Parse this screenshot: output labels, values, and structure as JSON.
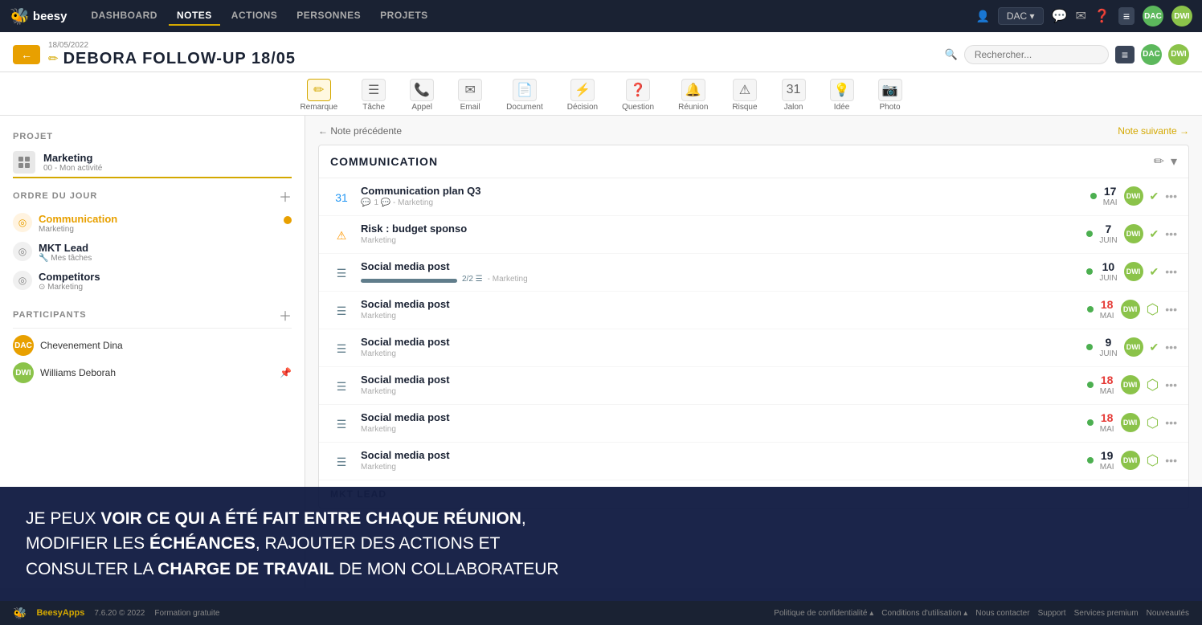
{
  "app": {
    "logo": "Beesy",
    "bee_icon": "🐝"
  },
  "topnav": {
    "items": [
      {
        "label": "DASHBOARD",
        "active": false
      },
      {
        "label": "NOTES",
        "active": true
      },
      {
        "label": "ACTIONS",
        "active": false
      },
      {
        "label": "PERSONNES",
        "active": false
      },
      {
        "label": "PROJETS",
        "active": false
      }
    ],
    "user_label": "DAC ▾",
    "search_placeholder": "Rechercher..."
  },
  "header": {
    "date": "18/05/2022",
    "title": "DEBORA FOLLOW-UP 18/05",
    "back_icon": "←",
    "edit_icon": "✏"
  },
  "toolbar": {
    "tools": [
      {
        "name": "Remarque",
        "icon": "✏"
      },
      {
        "name": "Tâche",
        "icon": "☰"
      },
      {
        "name": "Appel",
        "icon": "📞"
      },
      {
        "name": "Email",
        "icon": "✉"
      },
      {
        "name": "Document",
        "icon": "📄"
      },
      {
        "name": "Décision",
        "icon": "⚡"
      },
      {
        "name": "Question",
        "icon": "❓"
      },
      {
        "name": "Réunion",
        "icon": "🔔"
      },
      {
        "name": "Risque",
        "icon": "⚠"
      },
      {
        "name": "Jalon",
        "icon": "31"
      },
      {
        "name": "Idée",
        "icon": "💡"
      },
      {
        "name": "Photo",
        "icon": "📷"
      }
    ]
  },
  "sidebar": {
    "project_section": "PROJET",
    "agenda_section": "ORDRE DU JOUR",
    "participants_section": "PARTICIPANTS",
    "project": {
      "name": "Marketing",
      "sub": "00 - Mon activité"
    },
    "agenda_items": [
      {
        "name": "Communication",
        "sub": "Marketing",
        "active": true,
        "has_dot": true
      },
      {
        "name": "MKT Lead",
        "sub": "Mes tâches",
        "active": false,
        "has_dot": false
      },
      {
        "name": "Competitors",
        "sub": "Marketing",
        "active": false,
        "has_dot": false
      }
    ],
    "participants": [
      {
        "initials": "DAC",
        "name": "Chevenement Dina",
        "color": "#e8a000"
      },
      {
        "initials": "DWI",
        "name": "Williams Deborah",
        "color": "#8bc34a"
      }
    ]
  },
  "content": {
    "nav_prev": "← Note précédente",
    "nav_next": "Note suivante →",
    "section_name": "COMMUNICATION",
    "items": [
      {
        "icon": "31",
        "icon_type": "milestone",
        "title": "Communication plan Q3",
        "meta": "1 💬 - Marketing",
        "day": "17",
        "month": "MAI",
        "avatar": "DWI",
        "status": "check",
        "dot": true
      },
      {
        "icon": "⚠",
        "icon_type": "risk",
        "title": "Risk : budget sponso",
        "meta": "Marketing",
        "day": "7",
        "month": "JUIN",
        "avatar": "DWI",
        "status": "check",
        "dot": true
      },
      {
        "icon": "☰",
        "icon_type": "task",
        "title": "Social media post",
        "meta": "Marketing",
        "day": "10",
        "month": "JUIN",
        "avatar": "DWI",
        "status": "check",
        "dot": true,
        "progress": "2/2",
        "progress_pct": 100
      },
      {
        "icon": "☰",
        "icon_type": "task",
        "title": "Social media post",
        "meta": "Marketing",
        "day": "18",
        "month": "MAI",
        "avatar": "DWI",
        "status": "hex",
        "dot": true
      },
      {
        "icon": "☰",
        "icon_type": "task",
        "title": "Social media post",
        "meta": "Marketing",
        "day": "9",
        "month": "JUIN",
        "avatar": "DWI",
        "status": "check",
        "dot": true
      },
      {
        "icon": "☰",
        "icon_type": "task",
        "title": "Social media post",
        "meta": "Marketing",
        "day": "18",
        "month": "MAI",
        "avatar": "DWI",
        "status": "hex",
        "dot": true
      },
      {
        "icon": "☰",
        "icon_type": "task",
        "title": "Social media post",
        "meta": "Marketing",
        "day": "18",
        "month": "MAI",
        "avatar": "DWI",
        "status": "hex",
        "dot": true
      },
      {
        "icon": "☰",
        "icon_type": "task",
        "title": "Social media post",
        "meta": "Marketing",
        "day": "19",
        "month": "MAI",
        "avatar": "DWI",
        "status": "hex",
        "dot": true
      }
    ],
    "next_section": "MKT LEAD"
  },
  "bottom_overlay": {
    "text_parts": [
      {
        "text": "JE PEUX ",
        "bold": false
      },
      {
        "text": "VOIR CE QUI A ÉTÉ FAIT ENTRE CHAQUE RÉUNION",
        "bold": true
      },
      {
        "text": ",\nMODIFIER LES ",
        "bold": false
      },
      {
        "text": "ÉCHÉANCES",
        "bold": true
      },
      {
        "text": ", RAJOUTER DES ACTIONS ET\nCONSULTER LA ",
        "bold": false
      },
      {
        "text": "CHARGE DE TRAVAIL",
        "bold": true
      },
      {
        "text": " DE MON COLLABORATEUR",
        "bold": false
      }
    ]
  },
  "footer": {
    "logo": "BeesyApps",
    "version": "7.6.20 © 2022",
    "formation": "Formation gratuite",
    "links": [
      {
        "label": "Politique de confidentialité ▴"
      },
      {
        "label": "Conditions d'utilisation ▴"
      },
      {
        "label": "Nous contacter"
      },
      {
        "label": "Support"
      },
      {
        "label": "Services premium"
      },
      {
        "label": "Nouveautés"
      }
    ]
  }
}
